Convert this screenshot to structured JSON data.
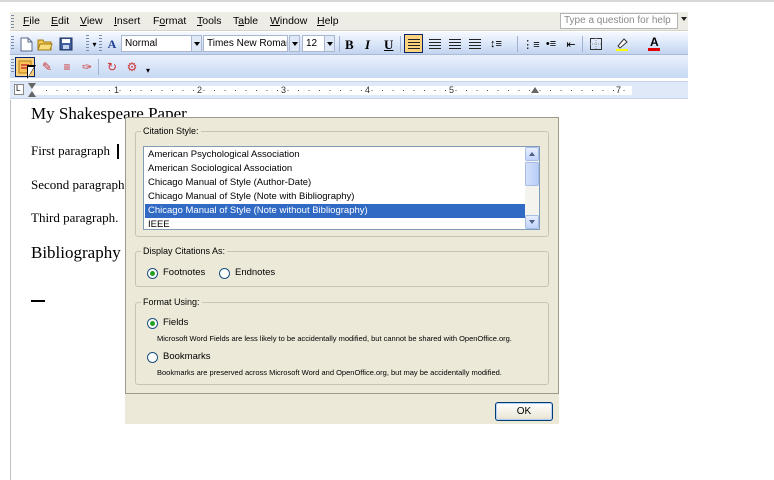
{
  "menu": {
    "items": [
      {
        "key": "F",
        "rest": "ile"
      },
      {
        "key": "E",
        "rest": "dit"
      },
      {
        "key": "V",
        "rest": "iew"
      },
      {
        "key": "I",
        "rest": "nsert"
      },
      {
        "key": "o",
        "pre": "F",
        "rest": "rmat"
      },
      {
        "key": "T",
        "rest": "ools"
      },
      {
        "pre": "T",
        "key": "a",
        "rest": "ble"
      },
      {
        "key": "W",
        "rest": "indow"
      },
      {
        "key": "H",
        "rest": "elp"
      }
    ],
    "help_placeholder": "Type a question for help"
  },
  "formatting": {
    "style": "Normal",
    "font": "Times New Roman",
    "size": "12",
    "bold": "B",
    "italic": "I",
    "underline": "U",
    "style_icon": "style-pane-icon",
    "font_color_label": "A"
  },
  "ruler": {
    "numbers": [
      "1",
      "2",
      "3",
      "4",
      "5",
      "7"
    ]
  },
  "document": {
    "title": "My Shakespeare Paper",
    "para1": "First paragraph",
    "para2": "Second paragraph",
    "para3": "Third paragraph.",
    "heading": "Bibliography"
  },
  "dialog": {
    "citation_style_label": "Citation Style:",
    "styles": [
      "American Psychological Association",
      "American Sociological Association",
      "Chicago Manual of Style (Author-Date)",
      "Chicago Manual of Style (Note with Bibliography)",
      "Chicago Manual of Style (Note without Bibliography)",
      "IEEE"
    ],
    "selected_index": 4,
    "display_label": "Display Citations As:",
    "footnotes_label": "Footnotes",
    "endnotes_label": "Endnotes",
    "display_value": "Footnotes",
    "format_label": "Format Using:",
    "fields_label": "Fields",
    "fields_desc": "Microsoft Word Fields are less likely to be accidentally modified, but cannot be shared with OpenOffice.org.",
    "bookmarks_label": "Bookmarks",
    "bookmarks_desc": "Bookmarks are preserved across Microsoft Word and OpenOffice.org, but may be accidentally modified.",
    "format_value": "Fields",
    "ok_label": "OK"
  },
  "colors": {
    "selection": "#316ac5",
    "dialog_bg": "#ece9d8",
    "toolbar": "#c7d8f3"
  }
}
